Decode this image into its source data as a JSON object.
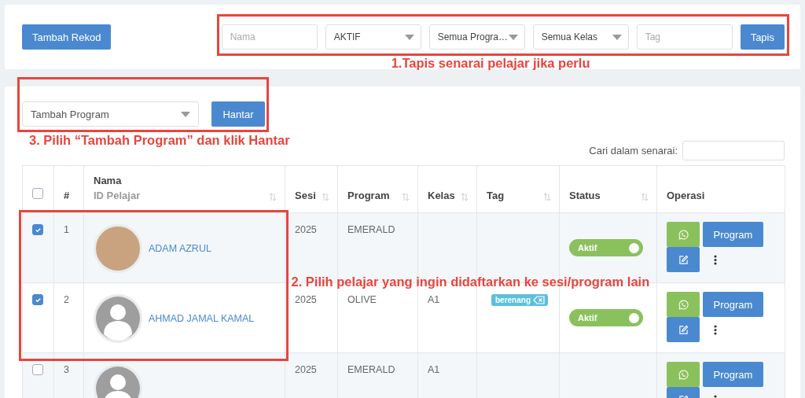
{
  "toolbar": {
    "add_button": "Tambah Rekod",
    "filters": [
      {
        "kind": "input",
        "placeholder": "Nama"
      },
      {
        "kind": "select",
        "value": "AKTIF"
      },
      {
        "kind": "select",
        "value": "Semua Progra…"
      },
      {
        "kind": "select",
        "value": "Semua Kelas"
      },
      {
        "kind": "input",
        "placeholder": "Tag"
      }
    ],
    "filter_button": "Tapis"
  },
  "bulk_action": {
    "select": "Tambah Program",
    "button": "Hantar"
  },
  "search": {
    "label": "Cari dalam senarai:"
  },
  "table": {
    "columns": [
      {
        "kind": "checkbox",
        "checked": false
      },
      {
        "kind": "text",
        "label": "#",
        "sortable": false
      },
      {
        "kind": "text",
        "label": "Nama",
        "sublabel": "ID Pelajar",
        "sortable": true
      },
      {
        "kind": "text",
        "label": "Sesi",
        "sortable": true
      },
      {
        "kind": "text",
        "label": "Program",
        "sortable": true
      },
      {
        "kind": "text",
        "label": "Kelas",
        "sortable": true
      },
      {
        "kind": "text",
        "label": "Tag",
        "sortable": true
      },
      {
        "kind": "text",
        "label": "Status",
        "sortable": true
      },
      {
        "kind": "text",
        "label": "Operasi",
        "sortable": false
      }
    ],
    "rows": [
      {
        "checked": true,
        "number": "1",
        "avatar": {
          "kind": "photo"
        },
        "name": "ADAM AZRUL",
        "sesi": "2025",
        "program": "EMERALD",
        "kelas": "",
        "tags": [],
        "status": {
          "label": "Aktif",
          "on": true
        },
        "program_button": "Program"
      },
      {
        "checked": true,
        "number": "2",
        "avatar": {
          "kind": "default"
        },
        "name": "AHMAD JAMAL KAMAL",
        "sesi": "2025",
        "program": "OLIVE",
        "kelas": "A1",
        "tags": [
          "berenang"
        ],
        "status": {
          "label": "Aktif",
          "on": true
        },
        "program_button": "Program"
      },
      {
        "checked": false,
        "number": "3",
        "avatar": {
          "kind": "default"
        },
        "sesi": "2025",
        "program": "EMERALD",
        "kelas": "A1",
        "tags": [],
        "program_button": "Program"
      }
    ]
  },
  "annotations": [
    {
      "kind": "filters",
      "text": "1.Tapis senarai pelajar jika perlu"
    },
    {
      "kind": "rows",
      "text": "2. Pilih pelajar yang ingin didaftarkan ke sesi/program lain"
    },
    {
      "kind": "bulk_action",
      "text": "3. Pilih “Tambah Program” dan klik Hantar"
    }
  ]
}
